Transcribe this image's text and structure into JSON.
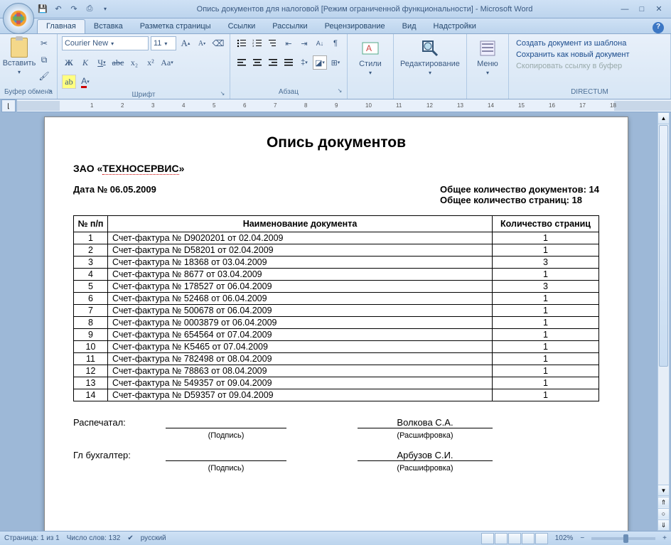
{
  "window": {
    "title": "Опись документов для налоговой [Режим ограниченной функциональности] - Microsoft Word"
  },
  "tabs": {
    "home": "Главная",
    "insert": "Вставка",
    "layout": "Разметка страницы",
    "refs": "Ссылки",
    "mail": "Рассылки",
    "review": "Рецензирование",
    "view": "Вид",
    "addins": "Надстройки"
  },
  "ribbon": {
    "clipboard": {
      "label": "Буфер обмена",
      "paste": "Вставить"
    },
    "font": {
      "label": "Шрифт",
      "name": "Courier New",
      "size": "11"
    },
    "paragraph": {
      "label": "Абзац"
    },
    "styles": {
      "label": "Стили"
    },
    "editing": {
      "label": "Редактирование"
    },
    "menu": {
      "label": "Меню"
    },
    "directum": {
      "label": "DIRECTUM",
      "create": "Создать документ из шаблона",
      "save": "Сохранить как новый документ",
      "copy": "Скопировать ссылку в буфер"
    }
  },
  "document": {
    "title": "Опись документов",
    "org_prefix": "ЗАО «",
    "org_name": "ТЕХНОСЕРВИС",
    "org_suffix": "»",
    "date_label": "Дата № 06.05.2009",
    "doc_count": "Общее количество документов: 14",
    "page_count": "Общее количество страниц: 18",
    "headers": {
      "num": "№ п/п",
      "name": "Наименование документа",
      "pages": "Количество страниц"
    },
    "rows": [
      {
        "n": "1",
        "name": "Счет-фактура № D9020201 от 02.04.2009",
        "p": "1"
      },
      {
        "n": "2",
        "name": "Счет-фактура № D58201 от 02.04.2009",
        "p": "1"
      },
      {
        "n": "3",
        "name": "Счет-фактура № 18368 от 03.04.2009",
        "p": "3"
      },
      {
        "n": "4",
        "name": "Счет-фактура № 8677 от 03.04.2009",
        "p": "1"
      },
      {
        "n": "5",
        "name": "Счет-фактура № 178527 от 06.04.2009",
        "p": "3"
      },
      {
        "n": "6",
        "name": "Счет-фактура № 52468 от 06.04.2009",
        "p": "1"
      },
      {
        "n": "7",
        "name": "Счет-фактура № 500678 от 06.04.2009",
        "p": "1"
      },
      {
        "n": "8",
        "name": "Счет-фактура № 0003879 от 06.04.2009",
        "p": "1"
      },
      {
        "n": "9",
        "name": "Счет-фактура № 654564 от 07.04.2009",
        "p": "1"
      },
      {
        "n": "10",
        "name": "Счет-фактура № K5465 от 07.04.2009",
        "p": "1"
      },
      {
        "n": "11",
        "name": "Счет-фактура № 782498 от 08.04.2009",
        "p": "1"
      },
      {
        "n": "12",
        "name": "Счет-фактура № 78863 от 08.04.2009",
        "p": "1"
      },
      {
        "n": "13",
        "name": "Счет-фактура № 549357 от 09.04.2009",
        "p": "1"
      },
      {
        "n": "14",
        "name": "Счет-фактура № D59357 от 09.04.2009",
        "p": "1"
      }
    ],
    "sig": {
      "printed_by": "Распечатал:",
      "signature_caption": "(Подпись)",
      "name1": "Волкова С.А.",
      "decode_caption": "(Расшифровка)",
      "chief": "Гл бухгалтер:",
      "name2": "Арбузов С.И."
    }
  },
  "status": {
    "page": "Страница: 1 из 1",
    "words": "Число слов: 132",
    "lang": "русский",
    "zoom": "102%"
  }
}
